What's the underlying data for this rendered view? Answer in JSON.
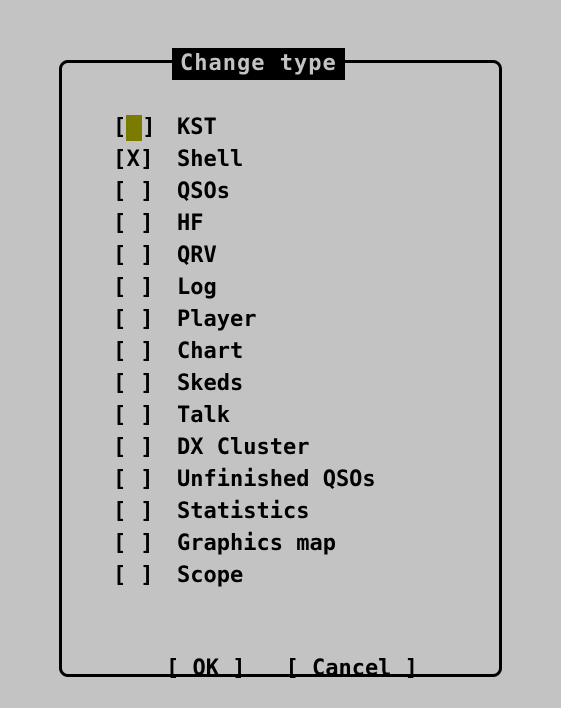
{
  "dialog": {
    "title": "Change type"
  },
  "items": [
    {
      "label": "KST",
      "checked": false,
      "focused": true
    },
    {
      "label": "Shell",
      "checked": true,
      "focused": false
    },
    {
      "label": "QSOs",
      "checked": false,
      "focused": false
    },
    {
      "label": "HF",
      "checked": false,
      "focused": false
    },
    {
      "label": "QRV",
      "checked": false,
      "focused": false
    },
    {
      "label": "Log",
      "checked": false,
      "focused": false
    },
    {
      "label": "Player",
      "checked": false,
      "focused": false
    },
    {
      "label": "Chart",
      "checked": false,
      "focused": false
    },
    {
      "label": "Skeds",
      "checked": false,
      "focused": false
    },
    {
      "label": "Talk",
      "checked": false,
      "focused": false
    },
    {
      "label": "DX Cluster",
      "checked": false,
      "focused": false
    },
    {
      "label": "Unfinished QSOs",
      "checked": false,
      "focused": false
    },
    {
      "label": "Statistics",
      "checked": false,
      "focused": false
    },
    {
      "label": "Graphics map",
      "checked": false,
      "focused": false
    },
    {
      "label": "Scope",
      "checked": false,
      "focused": false
    }
  ],
  "checkbox": {
    "open": "[",
    "close": "]",
    "checked_mark": "X",
    "unchecked_mark": " "
  },
  "buttons": {
    "ok_label": "[ OK ]",
    "cancel_label": "[ Cancel ]"
  },
  "colors": {
    "background": "#c3c3c3",
    "foreground": "#000000",
    "focus_cursor": "#7b7b00"
  }
}
